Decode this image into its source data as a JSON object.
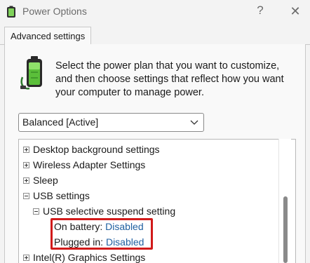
{
  "window": {
    "title": "Power Options",
    "help_glyph": "?",
    "close_glyph": "✕"
  },
  "tabs": [
    {
      "label": "Advanced settings"
    }
  ],
  "intro": {
    "text": "Select the power plan that you want to customize, and then choose settings that reflect how you want your computer to manage power.",
    "icon": "battery-plug-icon"
  },
  "plan_select": {
    "selected": "Balanced [Active]"
  },
  "settings_tree": {
    "items": [
      {
        "label": "Desktop background settings",
        "state": "collapsed"
      },
      {
        "label": "Wireless Adapter Settings",
        "state": "collapsed"
      },
      {
        "label": "Sleep",
        "state": "collapsed"
      },
      {
        "label": "USB settings",
        "state": "expanded"
      },
      {
        "label": "USB selective suspend setting",
        "state": "expanded"
      },
      {
        "label": "On battery:",
        "value": "Disabled"
      },
      {
        "label": "Plugged in:",
        "value": "Disabled"
      },
      {
        "label": "Intel(R) Graphics Settings",
        "state": "collapsed"
      }
    ]
  },
  "colors": {
    "highlight": "#d11a1a",
    "value_link": "#1f5fa0"
  }
}
